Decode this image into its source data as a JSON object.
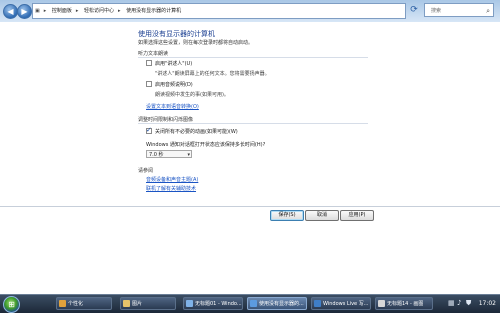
{
  "address": {
    "crumbs": [
      "控制面板",
      "轻松访问中心",
      "使用没有显示器的计算机"
    ],
    "search_placeholder": "搜索"
  },
  "page": {
    "title": "使用没有显示器的计算机",
    "subtitle": "如果选择这些设置，则在每次登录时都将自动启动。",
    "section_text_to_speech": "听力文本朗读",
    "narrator_label": "启用\"讲述人\"(U)",
    "narrator_desc": "\"讲述人\"朗读屏幕上的任何文本。您将需要扬声器。",
    "audio_desc_label": "启用音频说明(D)",
    "audio_desc_desc": "朗读视频中发生的事(如果可用)。",
    "tts_link": "设置文本到语音转换(O)",
    "section_timing": "调整时间限制和闪烁图像",
    "turn_off_anim_label": "关闭所有不必要的动画(如果可能)(W)",
    "notif_question": "Windows 通知对话框打开状态应该保持多长时间(H)?",
    "notif_value": "7.0 秒",
    "see_also_heading": "请参阅",
    "see_also_link1": "音频设备和声音主题(A)",
    "see_also_link2": "联机了解有关辅助技术"
  },
  "buttons": {
    "save": "保存(S)",
    "cancel": "取消",
    "apply": "应用(P)"
  },
  "checkboxes": {
    "narrator": false,
    "audio_desc": false,
    "turn_off_anim": true
  },
  "taskbar": {
    "items": [
      "个性化",
      "图片",
      "无标题01 - Windo...",
      "使用没有显示器的...",
      "Windows Live 写...",
      "无标题14 - 画图"
    ],
    "clock": "17:02"
  }
}
